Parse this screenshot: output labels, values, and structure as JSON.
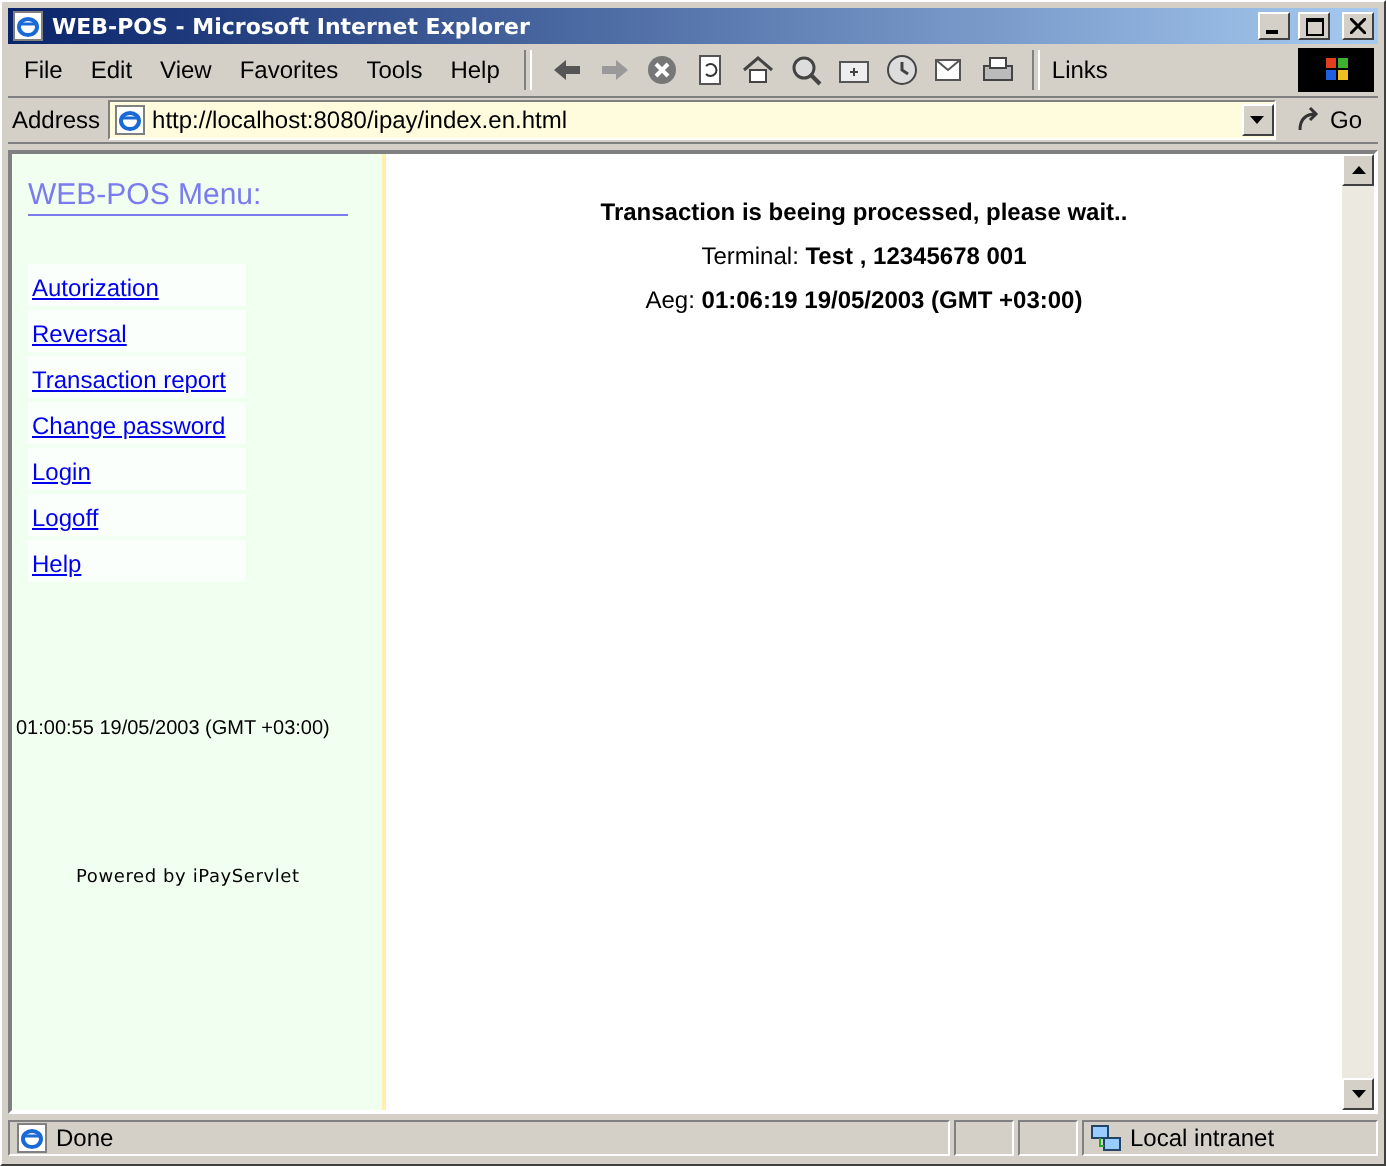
{
  "window": {
    "title": "WEB-POS - Microsoft Internet Explorer"
  },
  "menu": [
    "File",
    "Edit",
    "View",
    "Favorites",
    "Tools",
    "Help"
  ],
  "links_label": "Links",
  "address": {
    "label": "Address",
    "url": "http://localhost:8080/ipay/index.en.html",
    "go": "Go"
  },
  "sidebar": {
    "title": "WEB-POS Menu:",
    "items": [
      "Autorization",
      "Reversal",
      "Transaction report",
      "Change password",
      "Login",
      "Logoff",
      "Help"
    ],
    "clock": "01:00:55 19/05/2003 (GMT +03:00)",
    "powered": "Powered by iPayServlet"
  },
  "main": {
    "heading": "Transaction is beeing processed, please wait..",
    "lines": [
      "Terminal: **Test , 12345678 001**",
      "Aeg: **01:06:19 19/05/2003 (GMT +03:00)**"
    ]
  },
  "status_bar": {
    "text": "Done",
    "zone": "Local intranet"
  }
}
